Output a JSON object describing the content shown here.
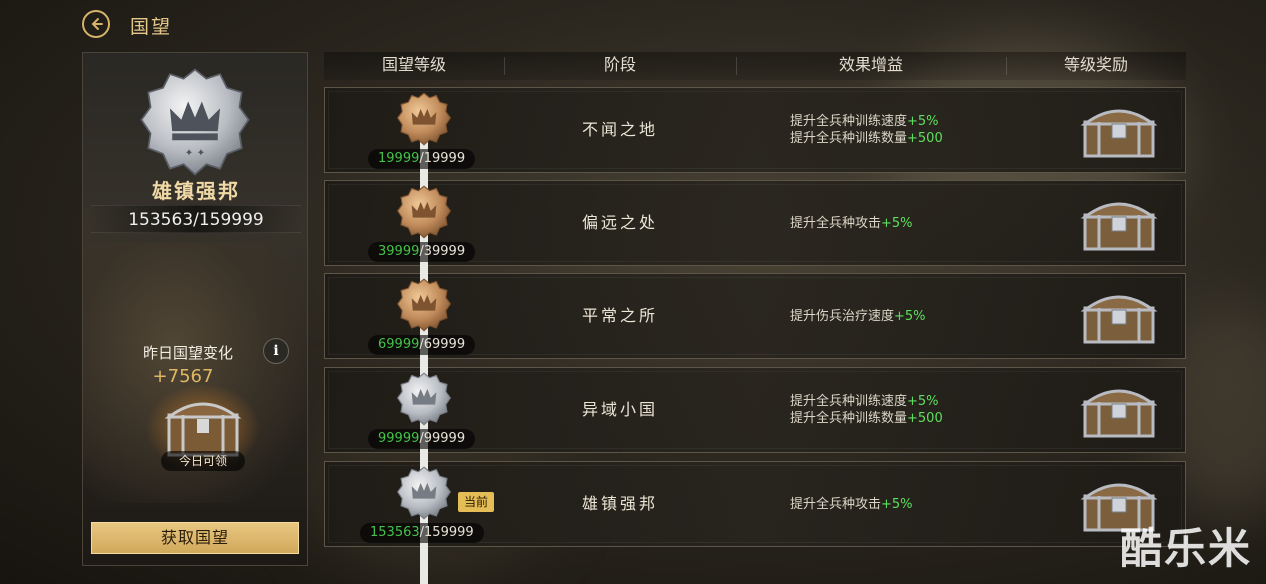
{
  "header": {
    "title": "国望"
  },
  "left": {
    "rank_name": "雄镇强邦",
    "progress": "153563/159999",
    "yesterday_label": "昨日国望变化",
    "info_symbol": "i",
    "yesterday_value": "+7567",
    "daily_label": "今日可领",
    "get_button": "获取国望"
  },
  "table": {
    "headers": [
      "国望等级",
      "阶段",
      "效果增益",
      "等级奖励"
    ],
    "rows": [
      {
        "cur": "19999",
        "max": "/19999",
        "stage": "不闻之地",
        "medal": "bronze",
        "effects": [
          {
            "text": "提升全兵种训练速度",
            "bonus": "+5%"
          },
          {
            "text": "提升全兵种训练数量",
            "bonus": "+500"
          }
        ]
      },
      {
        "cur": "39999",
        "max": "/39999",
        "stage": "偏远之处",
        "medal": "bronze",
        "effects": [
          {
            "text": "提升全兵种攻击",
            "bonus": "+5%"
          }
        ]
      },
      {
        "cur": "69999",
        "max": "/69999",
        "stage": "平常之所",
        "medal": "bronze",
        "effects": [
          {
            "text": "提升伤兵治疗速度",
            "bonus": "+5%"
          }
        ]
      },
      {
        "cur": "99999",
        "max": "/99999",
        "stage": "异域小国",
        "medal": "silver",
        "effects": [
          {
            "text": "提升全兵种训练速度",
            "bonus": "+5%"
          },
          {
            "text": "提升全兵种训练数量",
            "bonus": "+500"
          }
        ]
      },
      {
        "cur": "153563",
        "max": "/159999",
        "stage": "雄镇强邦",
        "medal": "silver",
        "current": true,
        "effects": [
          {
            "text": "提升全兵种攻击",
            "bonus": "+5%"
          }
        ]
      }
    ],
    "current_tag": "当前"
  },
  "watermark": "酷乐米",
  "colors": {
    "gold": "#e6c98a",
    "green": "#5ee05e",
    "button": "#d1a95c"
  }
}
